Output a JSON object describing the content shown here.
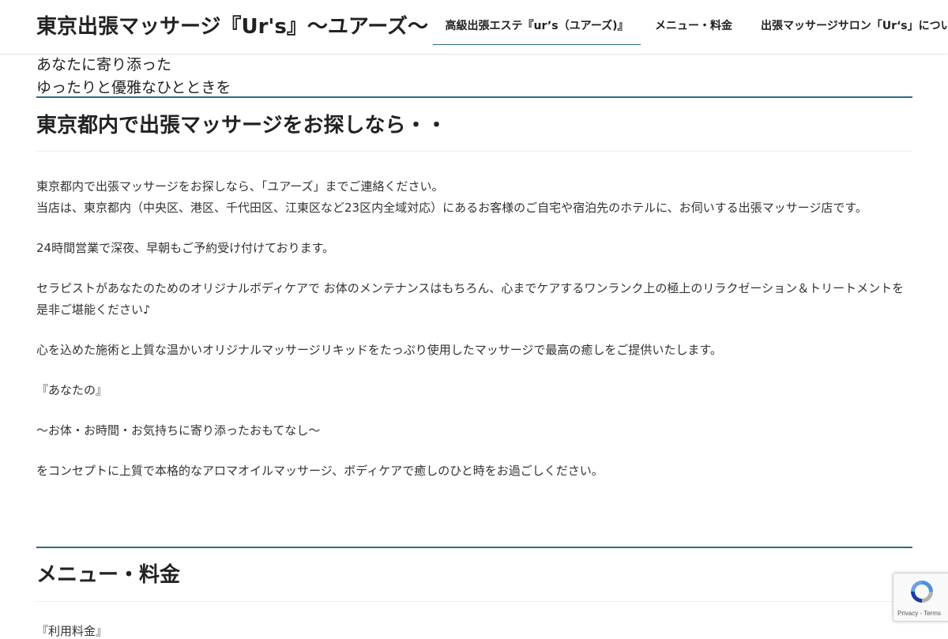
{
  "header": {
    "site_title": "東京出張マッサージ『Ur's』〜ユアーズ〜",
    "nav": [
      {
        "label": "高級出張エステ『ur’s（ユアーズ)』",
        "active": true
      },
      {
        "label": "メニュー・料金",
        "active": false
      },
      {
        "label": "出張マッサージサロン「Ur‘s」につい",
        "active": false
      }
    ]
  },
  "tagline": {
    "line1": "あなたに寄り添った",
    "line2": "ゆったりと優雅なひとときを"
  },
  "section1": {
    "title": "東京都内で出張マッサージをお探しなら・・",
    "paragraphs": [
      "東京都内で出張マッサージをお探しなら、「ユアーズ」までご連絡ください。",
      "当店は、東京都内（中央区、港区、千代田区、江東区など23区内全域対応）にあるお客様のご自宅や宿泊先のホテルに、お伺いする出張マッサージ店です。",
      "24時間営業で深夜、早朝もご予約受け付けております。",
      "セラピストがあなたのためのオリジナルボディケアで お体のメンテナンスはもちろん、心までケアするワンランク上の極上のリラクゼーション＆トリートメントを是非ご堪能ください♪",
      "心を込めた施術と上質な温かいオリジナルマッサージリキッドをたっぷり使用したマッサージで最高の癒しをご提供いたします。",
      "『あなたの』",
      "〜お体・お時間・お気持ちに寄り添ったおもてなし〜",
      "をコンセプトに上質で本格的なアロマオイルマッサージ、ボディケアで癒しのひと時をお過ごしください。"
    ]
  },
  "section2": {
    "title": "メニュー・料金",
    "partial_text": "『利用料金』"
  },
  "recaptcha": {
    "text": "Privacy - Terms"
  },
  "colors": {
    "accent": "#2c6a8a",
    "text": "#333333"
  }
}
